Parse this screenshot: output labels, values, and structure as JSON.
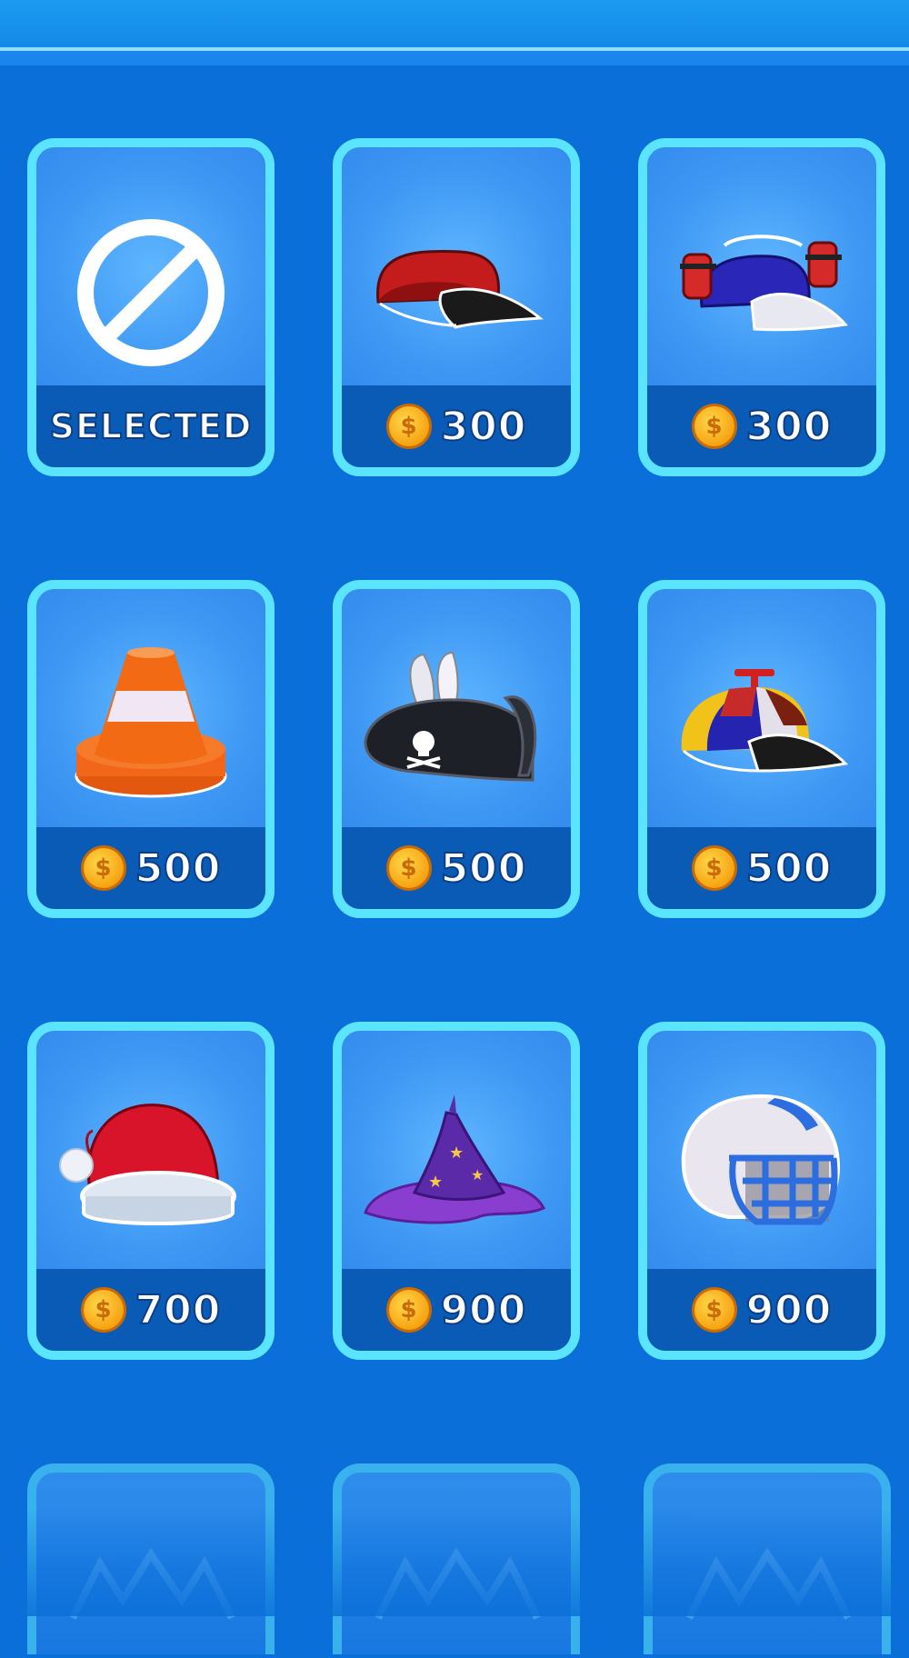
{
  "shop": {
    "items": [
      {
        "id": "none",
        "kind": "none",
        "status_label": "SELECTED",
        "icon": "no-symbol-icon"
      },
      {
        "id": "red-cap",
        "kind": "price",
        "price": "300",
        "icon": "red-cap-icon"
      },
      {
        "id": "drink-helmet",
        "kind": "price",
        "price": "300",
        "icon": "drink-helmet-cap-icon"
      },
      {
        "id": "traffic-cone",
        "kind": "price",
        "price": "500",
        "icon": "traffic-cone-icon"
      },
      {
        "id": "pirate-hat",
        "kind": "price",
        "price": "500",
        "icon": "pirate-hat-icon"
      },
      {
        "id": "propeller-cap",
        "kind": "price",
        "price": "500",
        "icon": "propeller-cap-icon"
      },
      {
        "id": "santa-hat",
        "kind": "price",
        "price": "700",
        "icon": "santa-hat-icon"
      },
      {
        "id": "wizard-hat",
        "kind": "price",
        "price": "900",
        "icon": "wizard-hat-icon"
      },
      {
        "id": "football-helmet",
        "kind": "price",
        "price": "900",
        "icon": "football-helmet-icon"
      }
    ],
    "coin_symbol": "$",
    "colors": {
      "background": "#0a6fd8",
      "card_border": "#5ae4ff",
      "price_bar": "#0a5bb5",
      "coin": "#f6a312"
    }
  }
}
